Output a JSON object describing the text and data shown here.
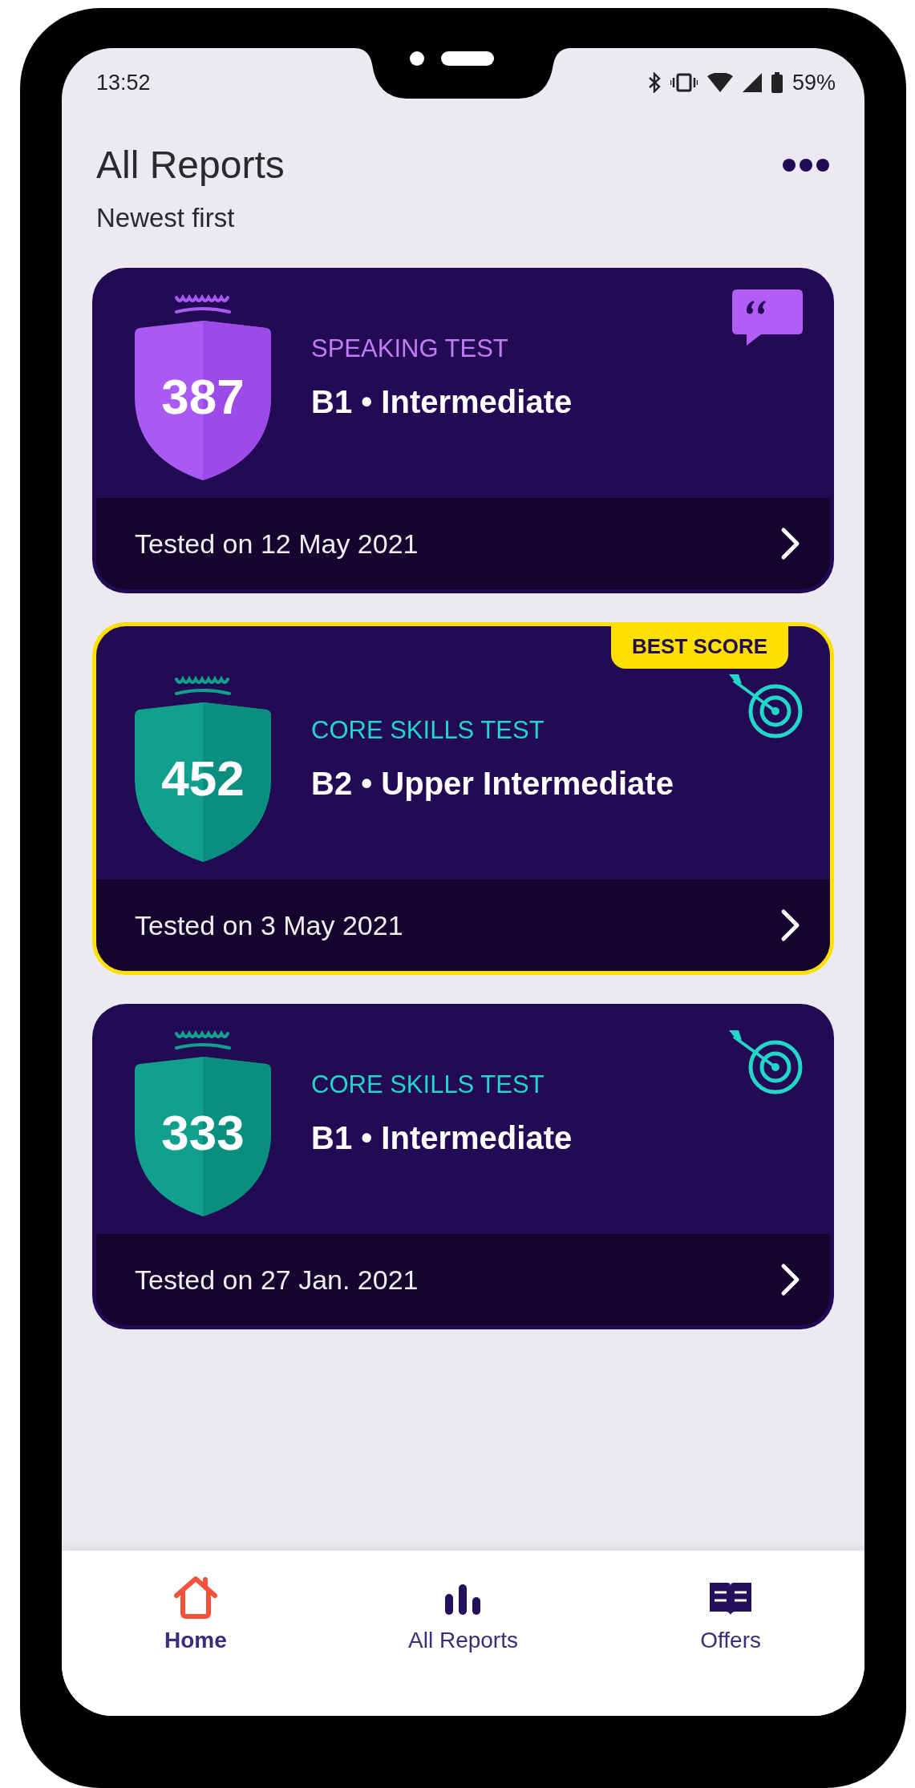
{
  "status_bar": {
    "time": "13:52",
    "battery": "59%"
  },
  "header": {
    "title": "All Reports",
    "subtitle": "Newest first"
  },
  "reports": [
    {
      "kind": "speaking",
      "score": "387",
      "test": "SPEAKING TEST",
      "level": "B1 • Intermediate",
      "date": "Tested on 12 May 2021",
      "best": false
    },
    {
      "kind": "core",
      "score": "452",
      "test": "CORE SKILLS TEST",
      "level": "B2 • Upper Intermediate",
      "date": "Tested on 3 May 2021",
      "best": true,
      "badge": "BEST SCORE"
    },
    {
      "kind": "core",
      "score": "333",
      "test": "CORE SKILLS TEST",
      "level": "B1 • Intermediate",
      "date": "Tested on 27 Jan. 2021",
      "best": false
    }
  ],
  "bottom_nav": [
    {
      "label": "Home",
      "selected": true
    },
    {
      "label": "All Reports",
      "selected": false
    },
    {
      "label": "Offers",
      "selected": false
    }
  ]
}
